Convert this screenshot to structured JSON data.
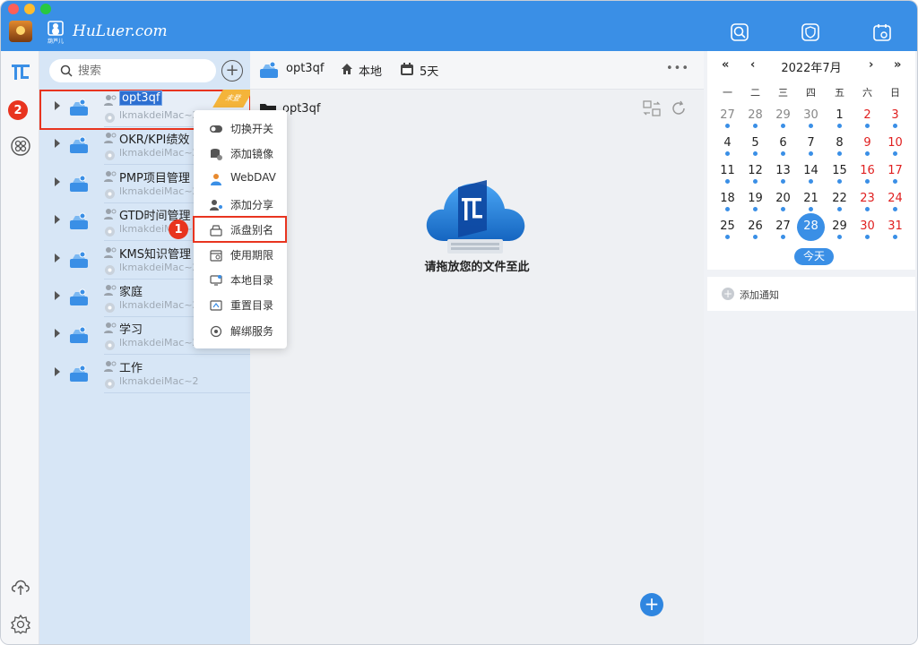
{
  "app": {
    "brand": "HuLuer.com",
    "logo_sub": "葫芦儿"
  },
  "colors": {
    "accent": "#3a8fe6",
    "highlight": "#e8341f",
    "weekend": "#e02020"
  },
  "titlebar_icons": [
    "search-icon",
    "shield-icon",
    "calendar-icon"
  ],
  "rail": {
    "badge_top": "2",
    "icons": [
      "app-logo-icon",
      "apps-grid-icon",
      "cloud-upload-icon",
      "settings-gear-icon"
    ]
  },
  "search": {
    "placeholder": "搜索"
  },
  "tree": {
    "items": [
      {
        "name": "opt3qf",
        "host": "lkmakdeiMac~2",
        "ribbon": "未登"
      },
      {
        "name": "OKR/KPI绩效",
        "host": "lkmakdeiMac~2"
      },
      {
        "name": "PMP项目管理",
        "host": "lkmakdeiMac~2"
      },
      {
        "name": "GTD时间管理",
        "host": "lkmakdeiMac~2"
      },
      {
        "name": "KMS知识管理",
        "host": "lkmakdeiMac~2"
      },
      {
        "name": "家庭",
        "host": "lkmakdeiMac~2"
      },
      {
        "name": "学习",
        "host": "lkmakdeiMac~2"
      },
      {
        "name": "工作",
        "host": "lkmakdeiMac~2"
      }
    ]
  },
  "menu": {
    "badge": "1",
    "items": [
      "切换开关",
      "添加镜像",
      "WebDAV",
      "添加分享",
      "派盘别名",
      "使用期限",
      "本地目录",
      "重置目录",
      "解绑服务"
    ]
  },
  "toolbar": {
    "drive": "opt3qf",
    "local": "本地",
    "days": "5天",
    "more": "•••"
  },
  "main": {
    "breadcrumb": "opt3qf",
    "drop_hint": "请拖放您的文件至此",
    "add": "+"
  },
  "calendar": {
    "title": "2022年7月",
    "nav": {
      "prev_year": "«",
      "prev_month": "‹",
      "next_month": "›",
      "next_year": "»"
    },
    "weekdays": [
      "一",
      "二",
      "三",
      "四",
      "五",
      "六",
      "日"
    ],
    "rows": [
      [
        "27",
        "28",
        "29",
        "30",
        "1",
        "2",
        "3"
      ],
      [
        "4",
        "5",
        "6",
        "7",
        "8",
        "9",
        "10"
      ],
      [
        "11",
        "12",
        "13",
        "14",
        "15",
        "16",
        "17"
      ],
      [
        "18",
        "19",
        "20",
        "21",
        "22",
        "23",
        "24"
      ],
      [
        "25",
        "26",
        "27",
        "28",
        "29",
        "30",
        "31"
      ]
    ],
    "today": "28",
    "today_label": "今天"
  },
  "notice": {
    "label": "添加通知"
  }
}
